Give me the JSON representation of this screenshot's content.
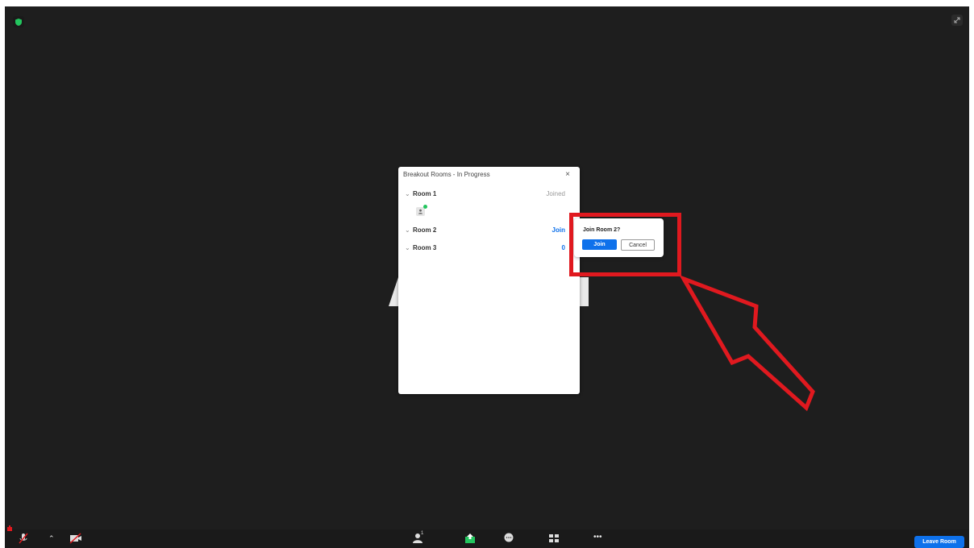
{
  "panel": {
    "title": "Breakout Rooms - In Progress",
    "close": "×",
    "rooms": [
      {
        "name": "Room 1",
        "status": "Joined"
      },
      {
        "name": "Room 2",
        "status": "Join"
      },
      {
        "name": "Room 3",
        "status": "0"
      }
    ]
  },
  "join_popup": {
    "question": "Join Room 2?",
    "join_label": "Join",
    "cancel_label": "Cancel"
  },
  "toolbar": {
    "leave_label": "Leave Room",
    "participants_count": "1",
    "more_label": "•••"
  },
  "colors": {
    "accent": "#0e71eb",
    "highlight": "#e0191f",
    "background": "#1e1e1e"
  }
}
